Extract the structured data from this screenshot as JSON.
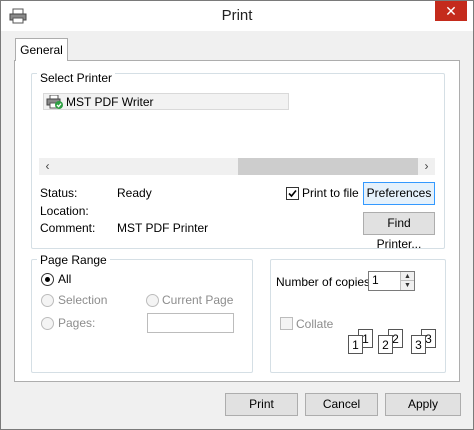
{
  "window": {
    "title": "Print",
    "close_glyph": "✕"
  },
  "tabs": [
    {
      "label": "General"
    }
  ],
  "select_printer": {
    "group_label": "Select Printer",
    "printers": [
      {
        "name": "MST PDF Writer",
        "selected": true,
        "icon": "printer-icon"
      }
    ],
    "scroll_left": "‹",
    "scroll_right": "›"
  },
  "printer_info": {
    "status_label": "Status:",
    "status_value": "Ready",
    "location_label": "Location:",
    "location_value": "",
    "comment_label": "Comment:",
    "comment_value": "MST PDF Printer",
    "print_to_file_label": "Print to file",
    "print_to_file_checked": true,
    "preferences_label": "Preferences",
    "find_printer_label": "Find Printer..."
  },
  "page_range": {
    "group_label": "Page Range",
    "all_label": "All",
    "selection_label": "Selection",
    "current_page_label": "Current Page",
    "pages_label": "Pages:",
    "pages_value": "",
    "selected_option": "All"
  },
  "copies": {
    "label": "Number of copies:",
    "value": "1",
    "collate_label": "Collate",
    "collate_checked": false,
    "collate_pages": [
      [
        "1",
        "1"
      ],
      [
        "2",
        "2"
      ],
      [
        "3",
        "3"
      ]
    ]
  },
  "footer": {
    "print_label": "Print",
    "cancel_label": "Cancel",
    "apply_label": "Apply"
  },
  "colors": {
    "close_button": "#c42b1c",
    "focus_border": "#3399ff",
    "scroll_thumb": "#cdcdcd"
  }
}
